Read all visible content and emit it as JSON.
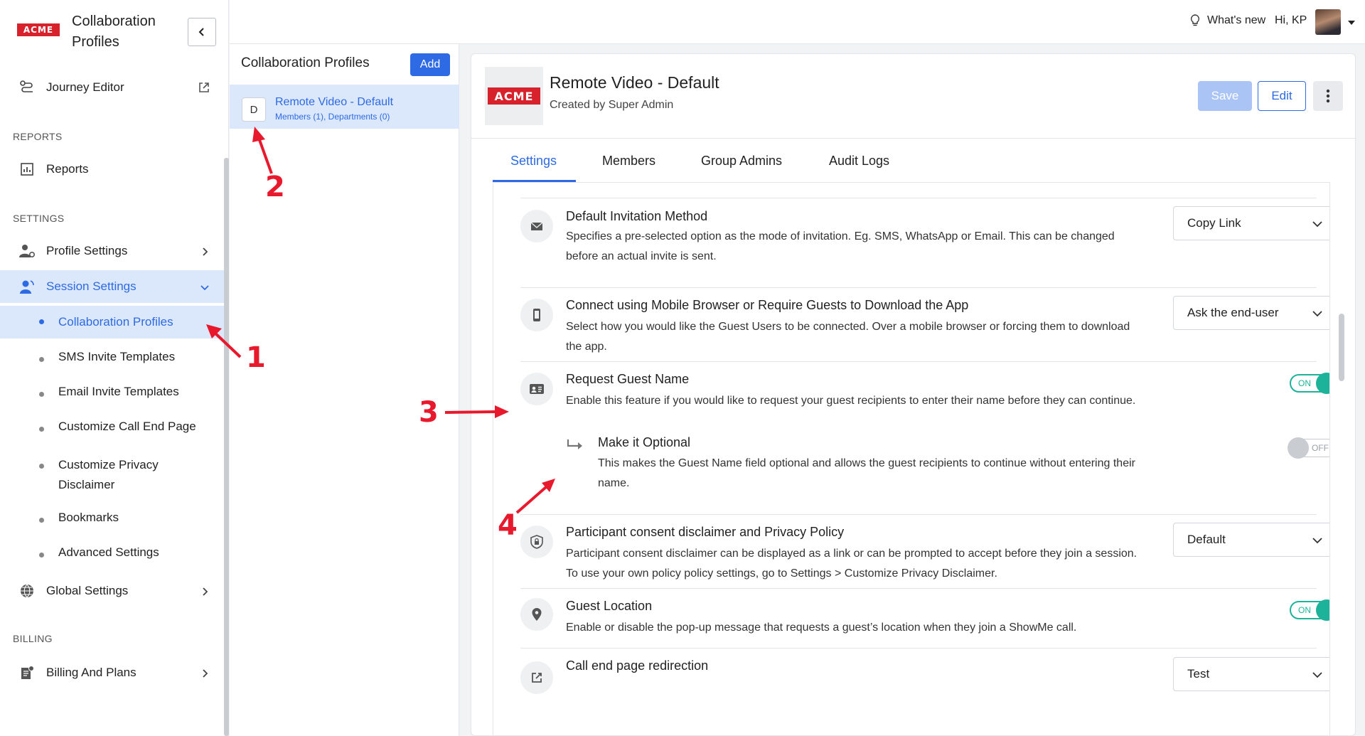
{
  "nav": {
    "logo": "ACME",
    "app_title": "Collaboration Profiles",
    "journey_editor": "Journey Editor",
    "reports_header": "REPORTS",
    "reports": "Reports",
    "settings_header": "SETTINGS",
    "profile_settings": "Profile Settings",
    "session_settings": "Session Settings",
    "session_items": [
      "Collaboration Profiles",
      "SMS Invite Templates",
      "Email Invite Templates",
      "Customize Call End Page",
      "Customize Privacy Disclaimer",
      "Bookmarks",
      "Advanced Settings"
    ],
    "global_settings": "Global Settings",
    "billing_header": "BILLING",
    "billing": "Billing And Plans"
  },
  "topbar": {
    "whats_new": "What's new",
    "greeting": "Hi, KP"
  },
  "middle": {
    "title": "Collaboration Profiles",
    "add_label": "Add",
    "item_badge": "D",
    "item_title": "Remote Video - Default",
    "item_sub": "Members (1), Departments (0)"
  },
  "card": {
    "logo": "ACME",
    "title": "Remote Video - Default",
    "subtitle": "Created by Super Admin",
    "save_label": "Save",
    "edit_label": "Edit",
    "tabs": [
      "Settings",
      "Members",
      "Group Admins",
      "Audit Logs"
    ]
  },
  "settings": {
    "invitation": {
      "title": "Default Invitation Method",
      "desc": "Specifies a pre-selected option as the mode of invitation. Eg. SMS, WhatsApp or Email. This can be changed before an actual invite is sent.",
      "value": "Copy Link"
    },
    "mobile": {
      "title": "Connect using Mobile Browser or Require Guests to Download the App",
      "desc": "Select how you would like the Guest Users to be connected. Over a mobile browser or forcing them to download the app.",
      "value": "Ask the end-user"
    },
    "guest_name": {
      "title": "Request Guest Name",
      "desc": "Enable this feature if you would like to request your guest recipients to enter their name before they can continue.",
      "toggle": "ON"
    },
    "optional": {
      "title": "Make it Optional",
      "desc": "This makes the Guest Name field optional and allows the guest recipients to continue without entering their name.",
      "toggle": "OFF"
    },
    "consent": {
      "title": "Participant consent disclaimer and Privacy Policy",
      "desc": "Participant consent disclaimer can be displayed as a link or can be prompted to accept before they join a session. To use your own policy policy settings, go to Settings > Customize Privacy Disclaimer.",
      "value": "Default"
    },
    "location": {
      "title": "Guest Location",
      "desc": "Enable or disable the pop-up message that requests a guest’s location when they join a ShowMe call.",
      "toggle": "ON"
    },
    "redirect": {
      "title": "Call end page redirection",
      "value": "Test"
    }
  },
  "annotations": [
    "1",
    "2",
    "3",
    "4"
  ],
  "colors": {
    "accent": "#2d6ae3",
    "brand": "#d8222b",
    "toggle_on": "#1db39a",
    "arrow": "#e8192c"
  }
}
